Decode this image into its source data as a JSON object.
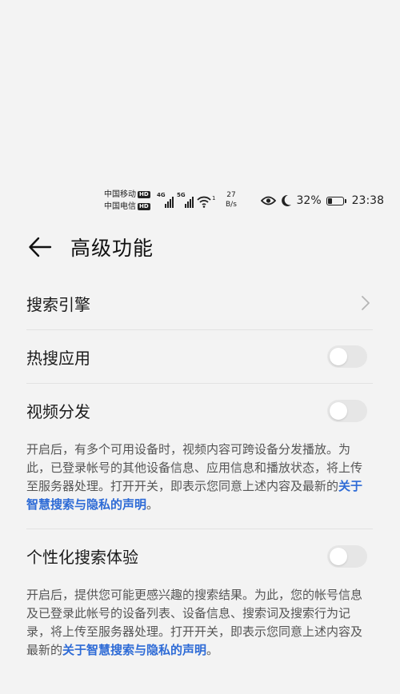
{
  "status_bar": {
    "carrier1": "中国移动",
    "carrier2": "中国电信",
    "hd_badge": "HD",
    "signal1_tech": "4G",
    "signal2_tech": "5G",
    "wifi_sup": "1",
    "net_speed_value": "27",
    "net_speed_unit": "B/s",
    "battery_percent": "32%",
    "battery_level": 0.32,
    "time": "23:38"
  },
  "header": {
    "title": "高级功能"
  },
  "settings": {
    "search_engine": {
      "label": "搜索引擎"
    },
    "hot_search": {
      "label": "热搜应用",
      "enabled": false
    },
    "video_distribution": {
      "label": "视频分发",
      "enabled": false,
      "description": "开启后，有多个可用设备时，视频内容可跨设备分发播放。为此，已登录帐号的其他设备信息、应用信息和播放状态，将上传至服务器处理。打开开关，即表示您同意上述内容及最新的",
      "link_text": "关于智慧搜索与隐私的声明",
      "suffix": "。"
    },
    "personalized_search": {
      "label": "个性化搜索体验",
      "enabled": false,
      "description": "开启后，提供您可能更感兴趣的搜索结果。为此，您的帐号信息及已登录此帐号的设备列表、设备信息、搜索词及搜索行为记录，将上传至服务器处理。打开开关，即表示您同意上述内容及最新的",
      "link_text": "关于智慧搜索与隐私的声明",
      "suffix": "。"
    }
  },
  "colors": {
    "background": "#f3f3f3",
    "link": "#2e6bd6",
    "toggle_off": "#e6e6e6"
  }
}
